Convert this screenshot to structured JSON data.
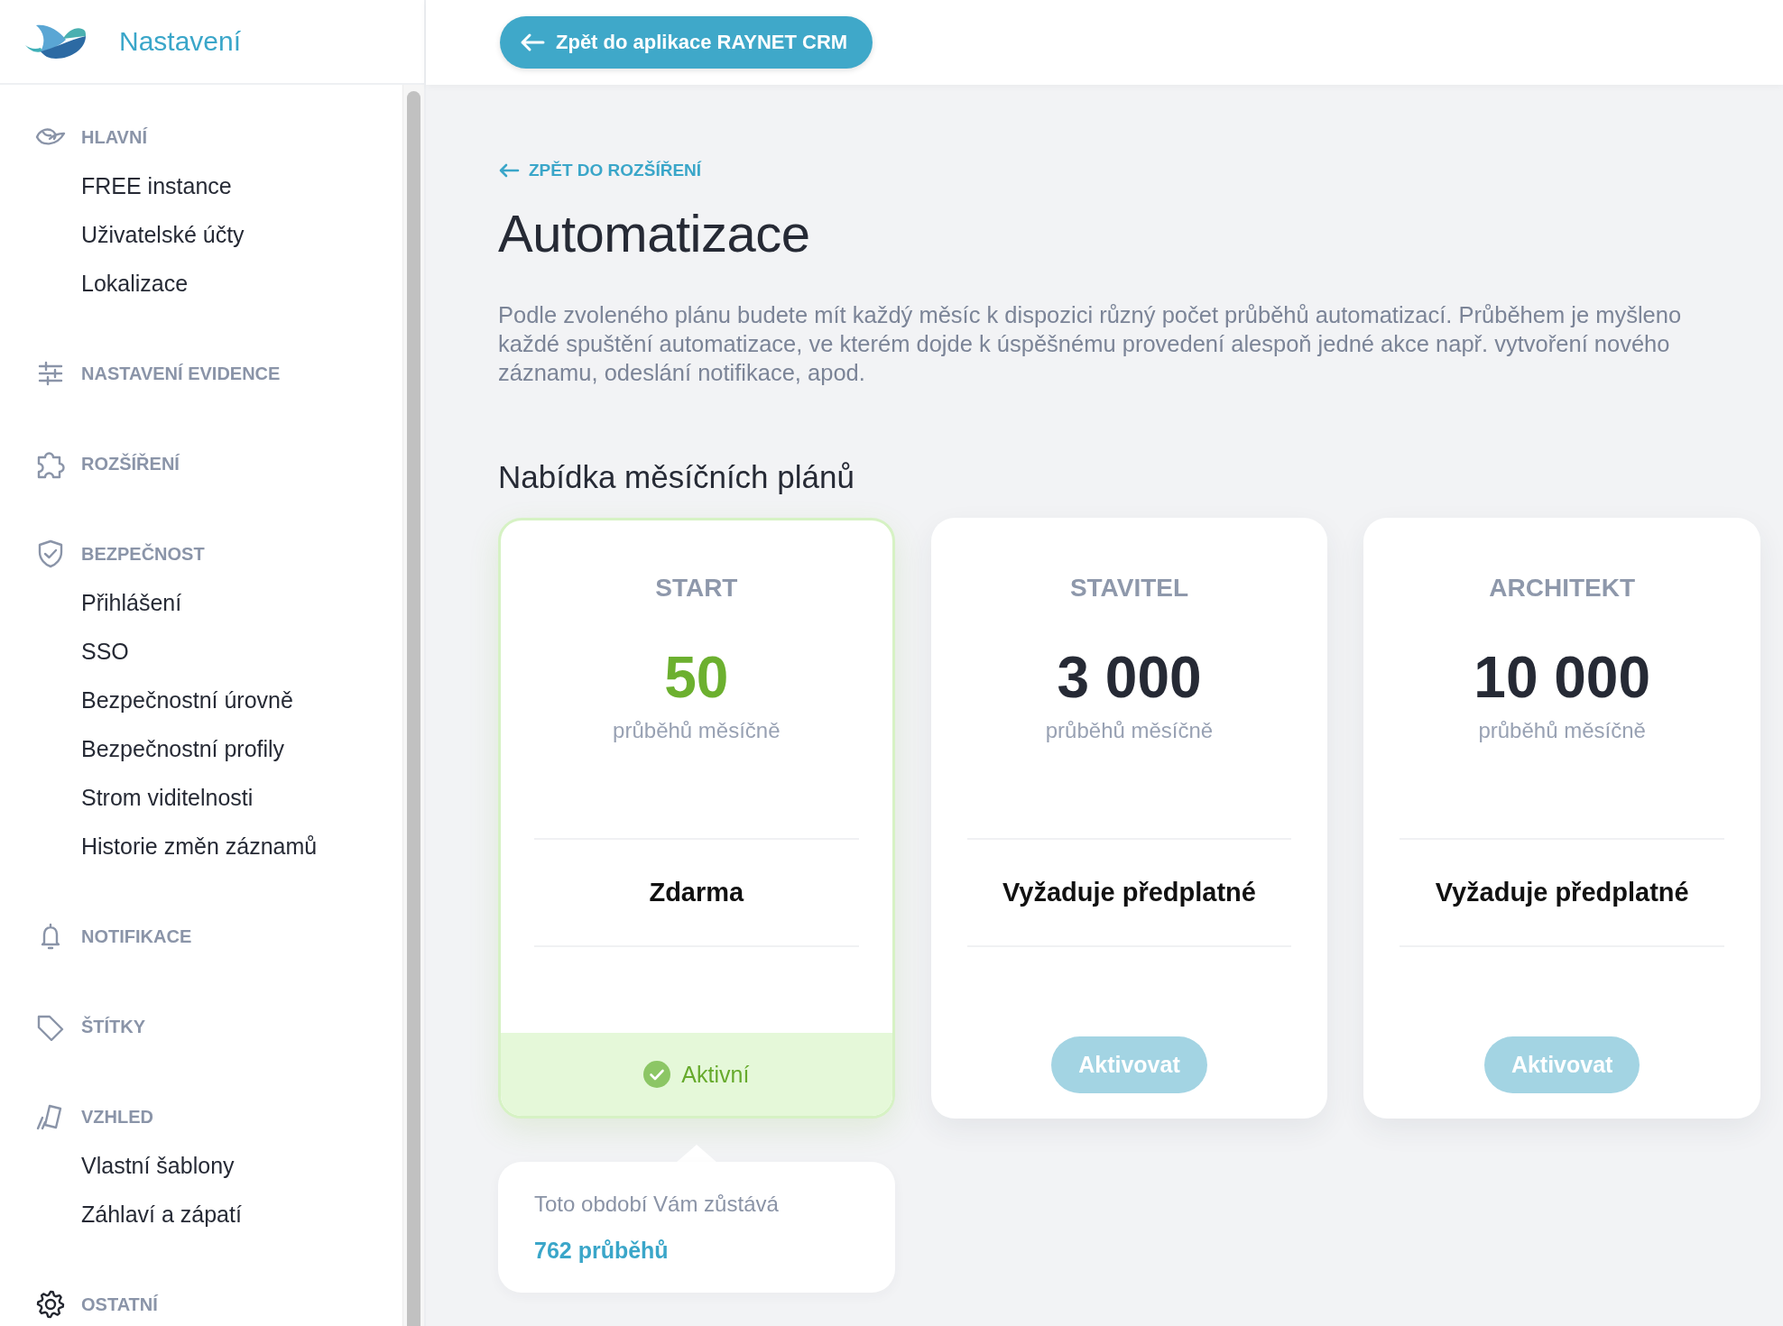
{
  "sidebar": {
    "title": "Nastavení",
    "sections": [
      {
        "label": "HLAVNÍ",
        "items": [
          "FREE instance",
          "Uživatelské účty",
          "Lokalizace"
        ]
      },
      {
        "label": "NASTAVENÍ EVIDENCE"
      },
      {
        "label": "ROZŠÍŘENÍ"
      },
      {
        "label": "BEZPEČNOST",
        "items": [
          "Přihlášení",
          "SSO",
          "Bezpečnostní úrovně",
          "Bezpečnostní profily",
          "Strom viditelnosti",
          "Historie změn záznamů"
        ]
      },
      {
        "label": "NOTIFIKACE"
      },
      {
        "label": "ŠTÍTKY"
      },
      {
        "label": "VZHLED",
        "items": [
          "Vlastní šablony",
          "Záhlaví a zápatí"
        ]
      },
      {
        "label": "OSTATNÍ"
      }
    ]
  },
  "top_bar": {
    "back_button": "Zpět do aplikace RAYNET CRM"
  },
  "content": {
    "back_link": "ZPĚT DO ROZŠÍŘENÍ",
    "title": "Automatizace",
    "description": "Podle zvoleného plánu budete mít každý měsíc k dispozici různý počet průběhů automatizací. Průběhem je myšleno každé spuštění automatizace, ve kterém dojde k úspěšnému provedení alespoň jedné akce např. vytvoření nového záznamu, odeslání notifikace, apod.",
    "plans_heading": "Nabídka měsíčních plánů",
    "plans": [
      {
        "name": "START",
        "count": "50",
        "unit": "průběhů měsíčně",
        "price": "Zdarma",
        "active": true,
        "status": "Aktivní"
      },
      {
        "name": "STAVITEL",
        "count": "3 000",
        "unit": "průběhů měsíčně",
        "price": "Vyžaduje předplatné",
        "active": false,
        "button": {
          "label": "Aktivovat",
          "disabled": true
        }
      },
      {
        "name": "ARCHITEKT",
        "count": "10 000",
        "unit": "průběhů měsíčně",
        "price": "Vyžaduje předplatné",
        "active": false,
        "button": {
          "label": "Aktivovat",
          "disabled": true
        }
      }
    ],
    "usage": {
      "label": "Toto období Vám zůstává",
      "value": "762 průběhů"
    }
  }
}
